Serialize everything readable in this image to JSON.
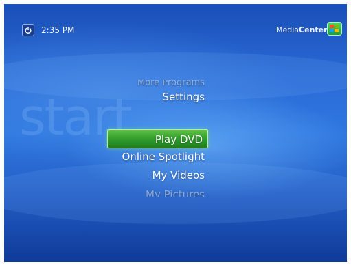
{
  "header": {
    "time": "2:35 PM",
    "brand_light": "Media",
    "brand_bold": "Center"
  },
  "watermark": "start",
  "menu": {
    "items": [
      {
        "label": "More Programs",
        "state": "partially-visible"
      },
      {
        "label": "Settings",
        "state": "normal"
      },
      {
        "label": "Play DVD",
        "state": "selected"
      },
      {
        "label": "Online Spotlight",
        "state": "normal"
      },
      {
        "label": "My Videos",
        "state": "normal"
      },
      {
        "label": "My Pictures",
        "state": "partially-visible"
      }
    ]
  },
  "icons": {
    "power": "power-icon",
    "logo": "windows-logo-icon"
  },
  "colors": {
    "background": "#2a6ad6",
    "selection": "#2e9a2a",
    "text": "#ffffff"
  }
}
